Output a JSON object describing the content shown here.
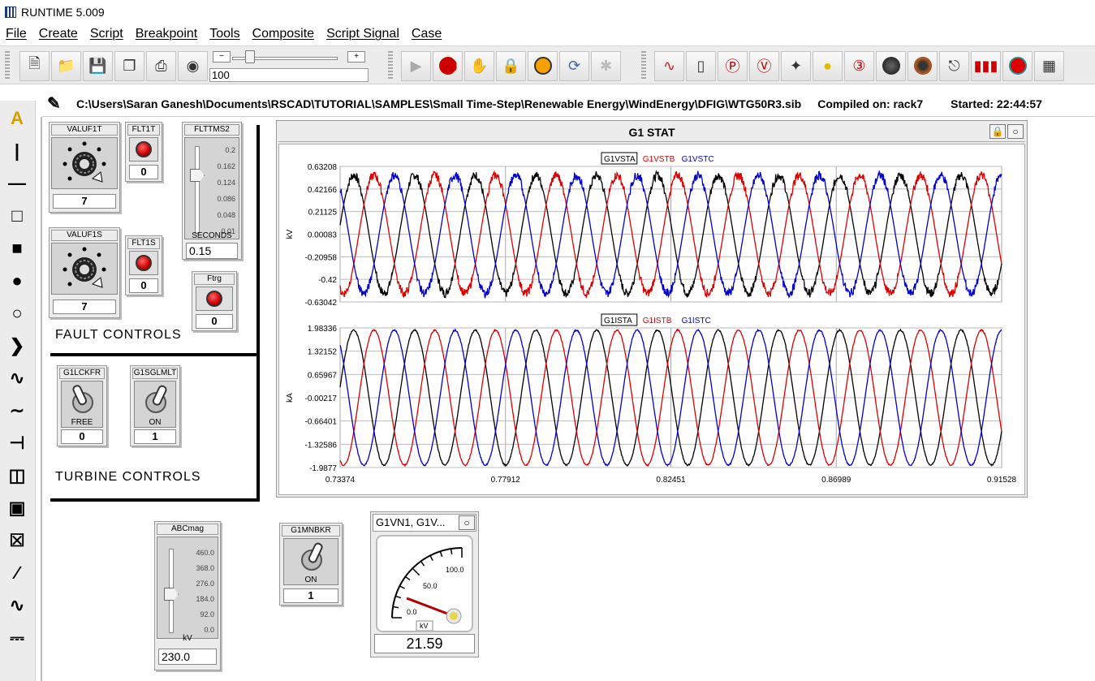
{
  "window": {
    "title": "RUNTIME 5.009"
  },
  "menu": [
    "File",
    "Create",
    "Script",
    "Breakpoint",
    "Tools",
    "Composite",
    "Script Signal",
    "Case"
  ],
  "toolbar": {
    "zoom_value": "100"
  },
  "pathbar": {
    "path": "C:\\Users\\Saran Ganesh\\Documents\\RSCAD\\TUTORIAL\\SAMPLES\\Small Time-Step\\Renewable Energy\\WindEnergy\\DFIG\\WTG50R3.sib",
    "compiled": "Compiled on: rack7",
    "started": "Started: 22:44:57"
  },
  "dials": [
    {
      "label": "VALUF1T",
      "value": "7"
    },
    {
      "label": "VALUF1S",
      "value": "7"
    }
  ],
  "buttons": [
    {
      "label": "FLT1T",
      "value": "0"
    },
    {
      "label": "FLT1S",
      "value": "0"
    },
    {
      "label": "Ftrg",
      "value": "0"
    }
  ],
  "flttms2": {
    "label": "FLTTMS2",
    "ticks": [
      "0.2",
      "0.162",
      "0.124",
      "0.086",
      "0.048",
      "0.01"
    ],
    "unit": "SECONDS",
    "value": "0.15",
    "level": 0.72
  },
  "sections": {
    "fault": "FAULT CONTROLS",
    "turbine": "TURBINE CONTROLS"
  },
  "toggles": [
    {
      "label": "G1LCKFR",
      "state": "FREE",
      "value": "0"
    },
    {
      "label": "G1SGLMLT",
      "state": "ON",
      "value": "1"
    },
    {
      "label": "G1MNBKR",
      "state": "ON",
      "value": "1"
    }
  ],
  "abcmag": {
    "label": "ABCmag",
    "ticks": [
      "460.0",
      "368.0",
      "276.0",
      "184.0",
      "92.0",
      "0.0"
    ],
    "unit": "kV",
    "value": "230.0",
    "level": 0.5
  },
  "meter": {
    "title": "G1VN1, G1V...",
    "ticks": [
      "0.0",
      "50.0",
      "100.0"
    ],
    "unit": "kV",
    "value": "21.59",
    "level": 0.216
  },
  "plot": {
    "title": "G1 STAT",
    "x_ticks": [
      "0.73374",
      "0.77912",
      "0.82451",
      "0.86989",
      "0.91528"
    ],
    "colors": {
      "a": "#000000",
      "b": "#dd0000",
      "c": "#0000cc"
    }
  },
  "chart_data": [
    {
      "type": "line",
      "ylabel": "kV",
      "legend": [
        "G1VSTA",
        "G1VSTB",
        "G1VSTC"
      ],
      "y_ticks": [
        "0.63208",
        "0.42166",
        "0.21125",
        "0.00083",
        "-0.20958",
        "-0.42",
        "-0.63042"
      ],
      "ylim": [
        -0.63042,
        0.63208
      ],
      "xlim": [
        0.73374,
        0.91528
      ],
      "amplitude": 0.55,
      "frequency_hz": 60,
      "noise": 0.04
    },
    {
      "type": "line",
      "ylabel": "kA",
      "legend": [
        "G1ISTA",
        "G1ISTB",
        "G1ISTC"
      ],
      "y_ticks": [
        "1.98336",
        "1.32152",
        "0.65967",
        "-0.00217",
        "-0.66401",
        "-1.32586",
        "-1.9877"
      ],
      "ylim": [
        -1.9877,
        1.98336
      ],
      "xlim": [
        0.73374,
        0.91528
      ],
      "amplitude": 1.92,
      "frequency_hz": 60,
      "noise": 0.02
    }
  ]
}
